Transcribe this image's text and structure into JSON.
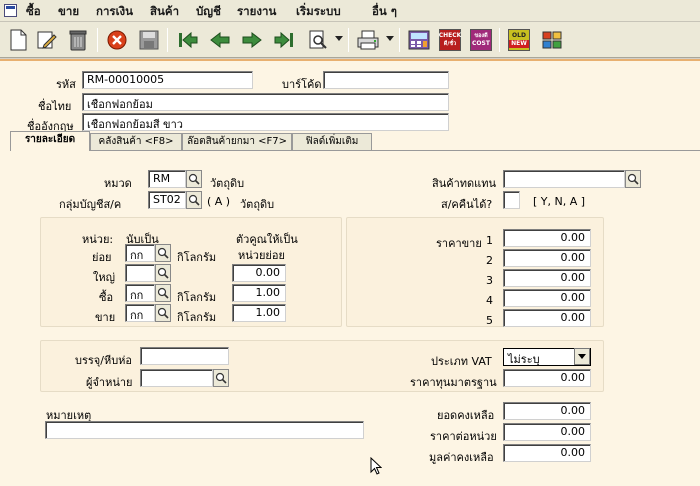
{
  "menu": [
    "ซื้อ",
    "ขาย",
    "การเงิน",
    "สินค้า",
    "บัญชี",
    "รายงาน",
    "เริ่มระบบ",
    "อื่น ๆ"
  ],
  "toolbar": {
    "badges": {
      "check": "CHECK",
      "check_sub": "ดี/ชั่ว",
      "cost_top": "ของดี",
      "cost": "COST",
      "gold_top": "OLD",
      "gold": "NEW"
    }
  },
  "header": {
    "code_label": "รหัส",
    "code_value": "RM-00010005",
    "barcode_label": "บาร์โค้ด",
    "barcode_value": "",
    "thai_name_label": "ชื่อไทย",
    "thai_name_value": "เชือกฟอกย้อม",
    "eng_name_label": "ชื่ออังกฤษ",
    "eng_name_value": "เชือกฟอกย้อมสี ขาว"
  },
  "tabs": [
    "รายละเอียด",
    "คลังสินค้า <F8>",
    "ล๊อตสินค้ายกมา <F7>",
    "ฟิลด์เพิ่มเติม"
  ],
  "details": {
    "category_label": "หมวด",
    "category_code": "RM",
    "category_name": "วัตถุดิบ",
    "account_group_label": "กลุ่มบัญชีส/ค",
    "account_group_code": "ST02",
    "account_group_type": "( A )",
    "account_group_name": "วัตถุดิบ",
    "substitute_label": "สินค้าทดแทน",
    "substitute_value": "",
    "returnable_label": "ส/คคืนได้?",
    "returnable_value": "",
    "returnable_options": "[ Y, N, A ]"
  },
  "units": {
    "unit_label": "หน่วย:",
    "count_as_label": "นับเป็น",
    "multiplier_label": "ตัวคูณให้เป็น",
    "sub_unit_label": "หน่วยย่อย",
    "rows": [
      {
        "label": "ย่อย",
        "code": "กก",
        "name": "กิโลกรัม",
        "factor": ""
      },
      {
        "label": "ใหญ่",
        "code": "",
        "name": "",
        "factor": "0.00"
      },
      {
        "label": "ซื้อ",
        "code": "กก",
        "name": "กิโลกรัม",
        "factor": "1.00"
      },
      {
        "label": "ขาย",
        "code": "กก",
        "name": "กิโลกรัม",
        "factor": "1.00"
      }
    ]
  },
  "prices": {
    "label": "ราคาขาย",
    "rows": [
      {
        "n": "1",
        "value": "0.00"
      },
      {
        "n": "2",
        "value": "0.00"
      },
      {
        "n": "3",
        "value": "0.00"
      },
      {
        "n": "4",
        "value": "0.00"
      },
      {
        "n": "5",
        "value": "0.00"
      }
    ]
  },
  "packaging": {
    "pack_label": "บรรจุ/หีบห่อ",
    "pack_value": "",
    "vendor_label": "ผู้จำหน่าย",
    "vendor_value": "",
    "vat_label": "ประเภท VAT",
    "vat_value": "ไม่ระบุ",
    "std_cost_label": "ราคาทุนมาตรฐาน",
    "std_cost_value": "0.00"
  },
  "footer": {
    "note_label": "หมายเหตุ",
    "note_value": "",
    "balance_label": "ยอดคงเหลือ",
    "balance_value": "0.00",
    "unit_cost_label": "ราคาต่อหน่วย",
    "unit_cost_value": "0.00",
    "balance_amount_label": "มูลค่าคงเหลือ",
    "balance_amount_value": "0.00"
  }
}
